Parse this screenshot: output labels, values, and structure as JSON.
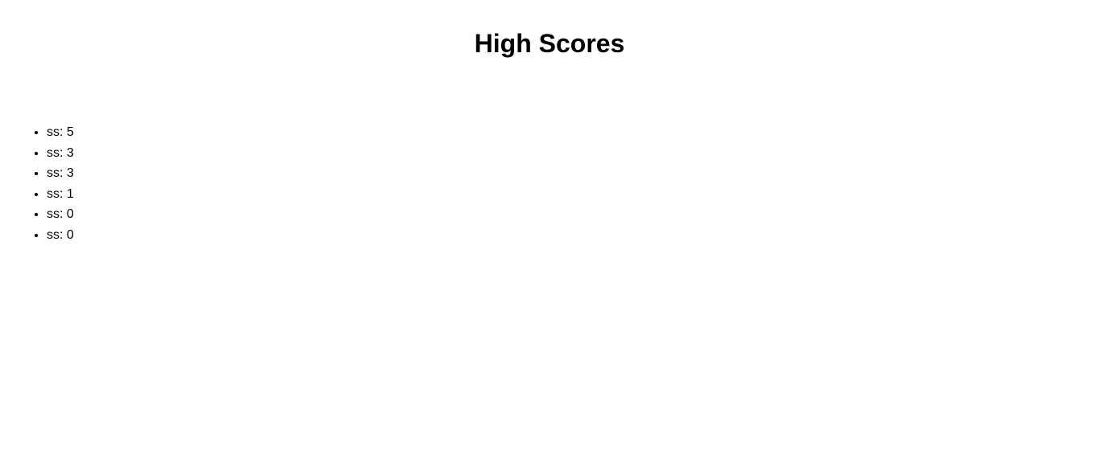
{
  "page": {
    "title": "High Scores"
  },
  "scores": [
    {
      "text": "ss: 5"
    },
    {
      "text": "ss: 3"
    },
    {
      "text": "ss: 3"
    },
    {
      "text": "ss: 1"
    },
    {
      "text": "ss: 0"
    },
    {
      "text": "ss: 0"
    }
  ]
}
